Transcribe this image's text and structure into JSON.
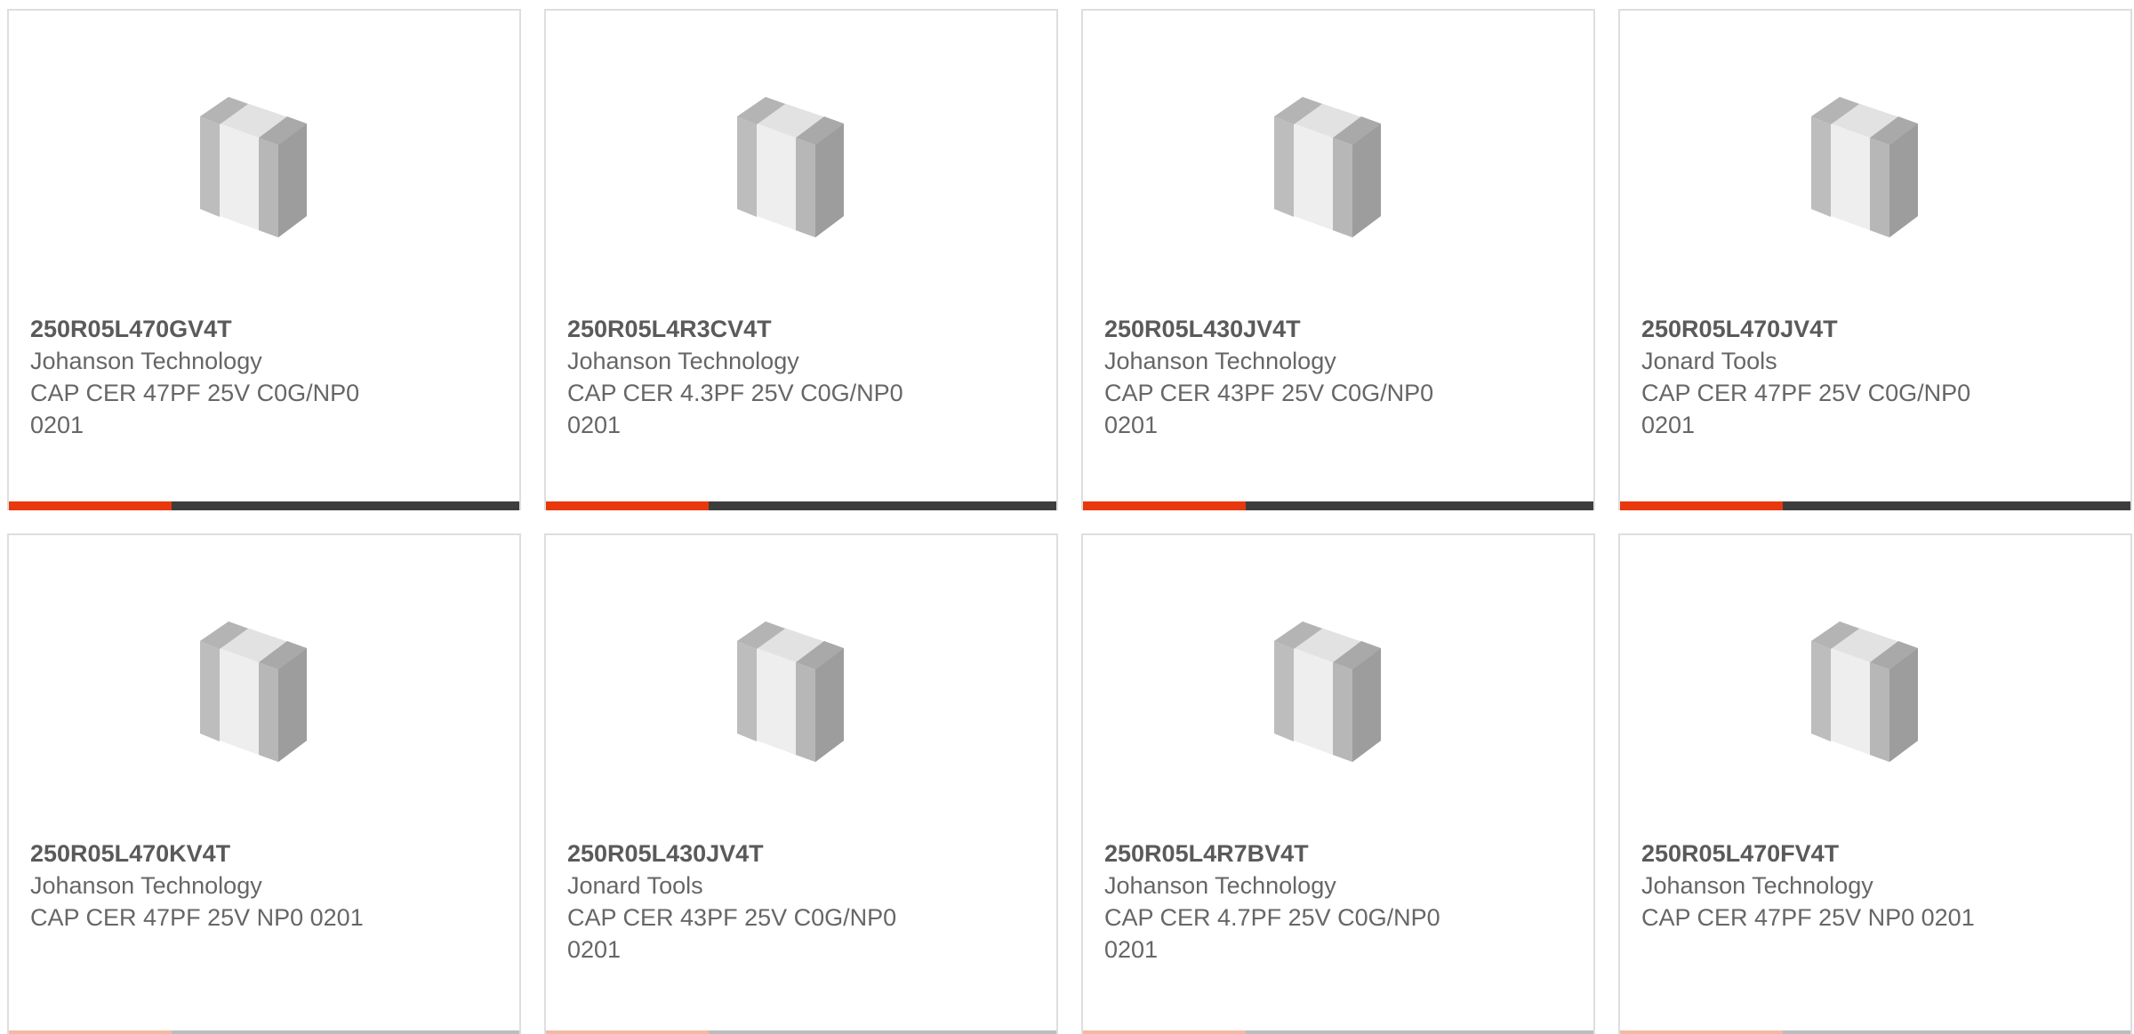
{
  "products": [
    {
      "part_number": "250R05L470GV4T",
      "manufacturer": "Johanson Technology",
      "description_line1": "CAP CER 47PF 25V C0G/NP0",
      "description_line2": "0201",
      "image_icon": "ceramic-capacitor-chip-icon"
    },
    {
      "part_number": "250R05L4R3CV4T",
      "manufacturer": "Johanson Technology",
      "description_line1": "CAP CER 4.3PF 25V C0G/NP0",
      "description_line2": "0201",
      "image_icon": "ceramic-capacitor-chip-icon"
    },
    {
      "part_number": "250R05L430JV4T",
      "manufacturer": "Johanson Technology",
      "description_line1": "CAP CER 43PF 25V C0G/NP0",
      "description_line2": "0201",
      "image_icon": "ceramic-capacitor-chip-icon"
    },
    {
      "part_number": "250R05L470JV4T",
      "manufacturer": "Jonard Tools",
      "description_line1": "CAP CER 47PF 25V C0G/NP0",
      "description_line2": "0201",
      "image_icon": "ceramic-capacitor-chip-icon"
    },
    {
      "part_number": "250R05L470KV4T",
      "manufacturer": "Johanson Technology",
      "description_line1": "CAP CER 47PF 25V NP0 0201",
      "description_line2": "",
      "image_icon": "ceramic-capacitor-chip-icon"
    },
    {
      "part_number": "250R05L430JV4T",
      "manufacturer": "Jonard Tools",
      "description_line1": "CAP CER 43PF 25V C0G/NP0",
      "description_line2": "0201",
      "image_icon": "ceramic-capacitor-chip-icon"
    },
    {
      "part_number": "250R05L4R7BV4T",
      "manufacturer": "Johanson Technology",
      "description_line1": "CAP CER 4.7PF 25V C0G/NP0",
      "description_line2": "0201",
      "image_icon": "ceramic-capacitor-chip-icon"
    },
    {
      "part_number": "250R05L470FV4T",
      "manufacturer": "Johanson Technology",
      "description_line1": "CAP CER 47PF 25V NP0 0201",
      "description_line2": "",
      "image_icon": "ceramic-capacitor-chip-icon"
    }
  ],
  "colors": {
    "accent": "#e8380d",
    "bar_dark": "#3d3d3d",
    "border": "#dedede",
    "text": "#666666"
  }
}
